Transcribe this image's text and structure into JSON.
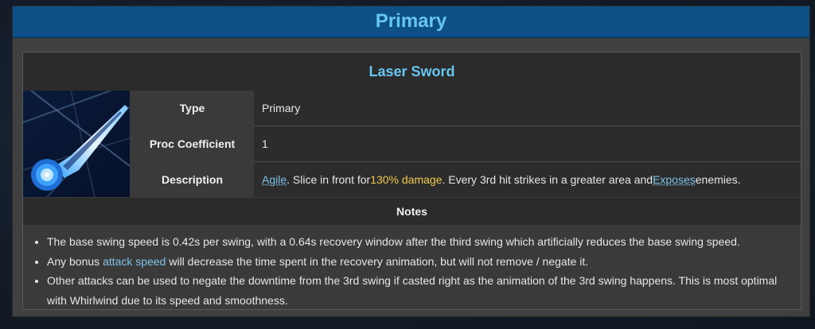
{
  "panel": {
    "title": "Primary"
  },
  "skill": {
    "name": "Laser Sword",
    "icon": "laser-sword-icon",
    "rows": {
      "type": {
        "label": "Type",
        "value": "Primary"
      },
      "proc": {
        "label": "Proc Coefficient",
        "value": "1"
      },
      "description": {
        "label": "Description",
        "agile": "Agile",
        "text1": ". Slice in front for ",
        "damage": "130% damage",
        "text2": ". Every 3rd hit strikes in a greater area and ",
        "exposes": "Exposes",
        "text3": " enemies."
      }
    }
  },
  "notes": {
    "title": "Notes",
    "items": {
      "n1": "The base swing speed is 0.42s per swing, with a 0.64s recovery window after the third swing which artificially reduces the base swing speed.",
      "n2_pre": "Any bonus ",
      "n2_link": "attack speed",
      "n2_post": " will decrease the time spent in the recovery animation, but will not remove / negate it.",
      "n3": "Other attacks can be used to negate the downtime from the 3rd swing if casted right as the animation of the 3rd swing happens. This is most optimal with Whirlwind due to its speed and smoothness."
    }
  },
  "colors": {
    "header_bg": "#0d4f87",
    "title_accent": "#67c6ef",
    "link": "#7dc3e8",
    "damage": "#f2c94c"
  }
}
